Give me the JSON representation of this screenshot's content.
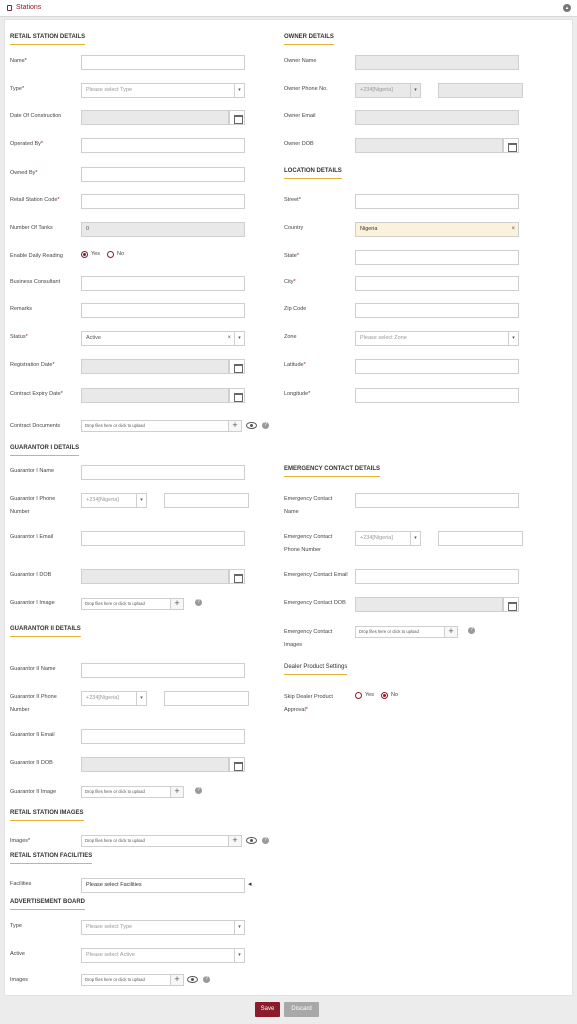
{
  "topbar": {
    "title": "Stations",
    "icon": "station-icon",
    "collapse_icon": "chevron-up-icon"
  },
  "retail": {
    "title": "RETAIL STATION DETAILS",
    "name_label": "Name",
    "type_label": "Type",
    "type_placeholder": "Please select Type",
    "doc_label": "Date Of Construction",
    "operated_label": "Operated By",
    "owned_label": "Owned By",
    "code_label": "Retail Station Code",
    "tanks_label": "Number Of Tanks",
    "tanks_value": "0",
    "reading_label": "Enable Daily Reading",
    "yes": "Yes",
    "no": "No",
    "consultant_label": "Business Consultant",
    "remarks_label": "Remarks",
    "status_label": "Status",
    "status_value": "Active",
    "regdate_label": "Registration Date",
    "expiry_label": "Contract Expiry Date",
    "docs_label": "Contract Documents",
    "upload_placeholder": "Drop files here or click to upload"
  },
  "owner": {
    "title": "OWNER DETAILS",
    "name_label": "Owner Name",
    "phone_label": "Owner Phone No.",
    "phone_code": "+234[Nigeria]",
    "email_label": "Owner Email",
    "dob_label": "Owner DOB"
  },
  "location": {
    "title": "LOCATION DETAILS",
    "street_label": "Street",
    "country_label": "Country",
    "country_value": "Nigeria",
    "state_label": "State",
    "city_label": "City",
    "zip_label": "Zip Code",
    "zone_label": "Zone",
    "zone_placeholder": "Please select Zone",
    "lat_label": "Latitude",
    "long_label": "Longitude"
  },
  "g1": {
    "title": "GUARANTOR I DETAILS",
    "name_label": "Guarantor I Name",
    "phone_label_1": "Guarantor I Phone",
    "phone_label_2": "Number",
    "phone_code": "+234[Nigeria]",
    "email_label": "Guarantor I Email",
    "dob_label": "Guarantor I DOB",
    "image_label": "Guarantor I Image",
    "upload_placeholder": "Drop files here or click to upload"
  },
  "g2": {
    "title": "GUARANTOR II DETAILS",
    "name_label": "Guarantor II Name",
    "phone_label_1": "Guarantor II Phone",
    "phone_label_2": "Number",
    "phone_code": "+234[Nigeria]",
    "email_label": "Guarantor II Email",
    "dob_label": "Guarantor II DOB",
    "image_label": "Guarantor II Image",
    "upload_placeholder": "Drop files here or click to upload"
  },
  "emergency": {
    "title": "EMERGENCY CONTACT DETAILS",
    "name_label_1": "Emergency Contact",
    "name_label_2": "Name",
    "phone_label_1": "Emergency Contact",
    "phone_label_2": "Phone Number",
    "phone_code": "+234[Nigeria]",
    "email_label": "Emergency Contact Email",
    "dob_label": "Emergency Contact DOB",
    "images_label_1": "Emergency Contact",
    "images_label_2": "Images",
    "upload_placeholder": "Drop files here or click to upload"
  },
  "dealer": {
    "title": "Dealer Product Settings",
    "skip_label_1": "Skip Dealer Product",
    "skip_label_2": "Approval",
    "yes": "Yes",
    "no": "No"
  },
  "images": {
    "title": "RETAIL STATION IMAGES",
    "label": "Images",
    "upload_placeholder": "Drop files here or click to upload"
  },
  "facilities": {
    "title": "RETAIL STATION FACILITIES",
    "label": "Facilities",
    "placeholder": "Please select Facilities"
  },
  "ad": {
    "title": "ADVERTISEMENT BOARD",
    "type_label": "Type",
    "type_placeholder": "Please select Type",
    "active_label": "Active",
    "active_placeholder": "Please select Active",
    "images_label": "Images",
    "upload_placeholder": "Drop files here or click to upload"
  },
  "footer": {
    "save": "Save",
    "discard": "Discard"
  },
  "common": {
    "required_mark": "*",
    "caret": "▾",
    "clear": "×",
    "plus": "+",
    "help": "?",
    "arrow": "◂"
  }
}
